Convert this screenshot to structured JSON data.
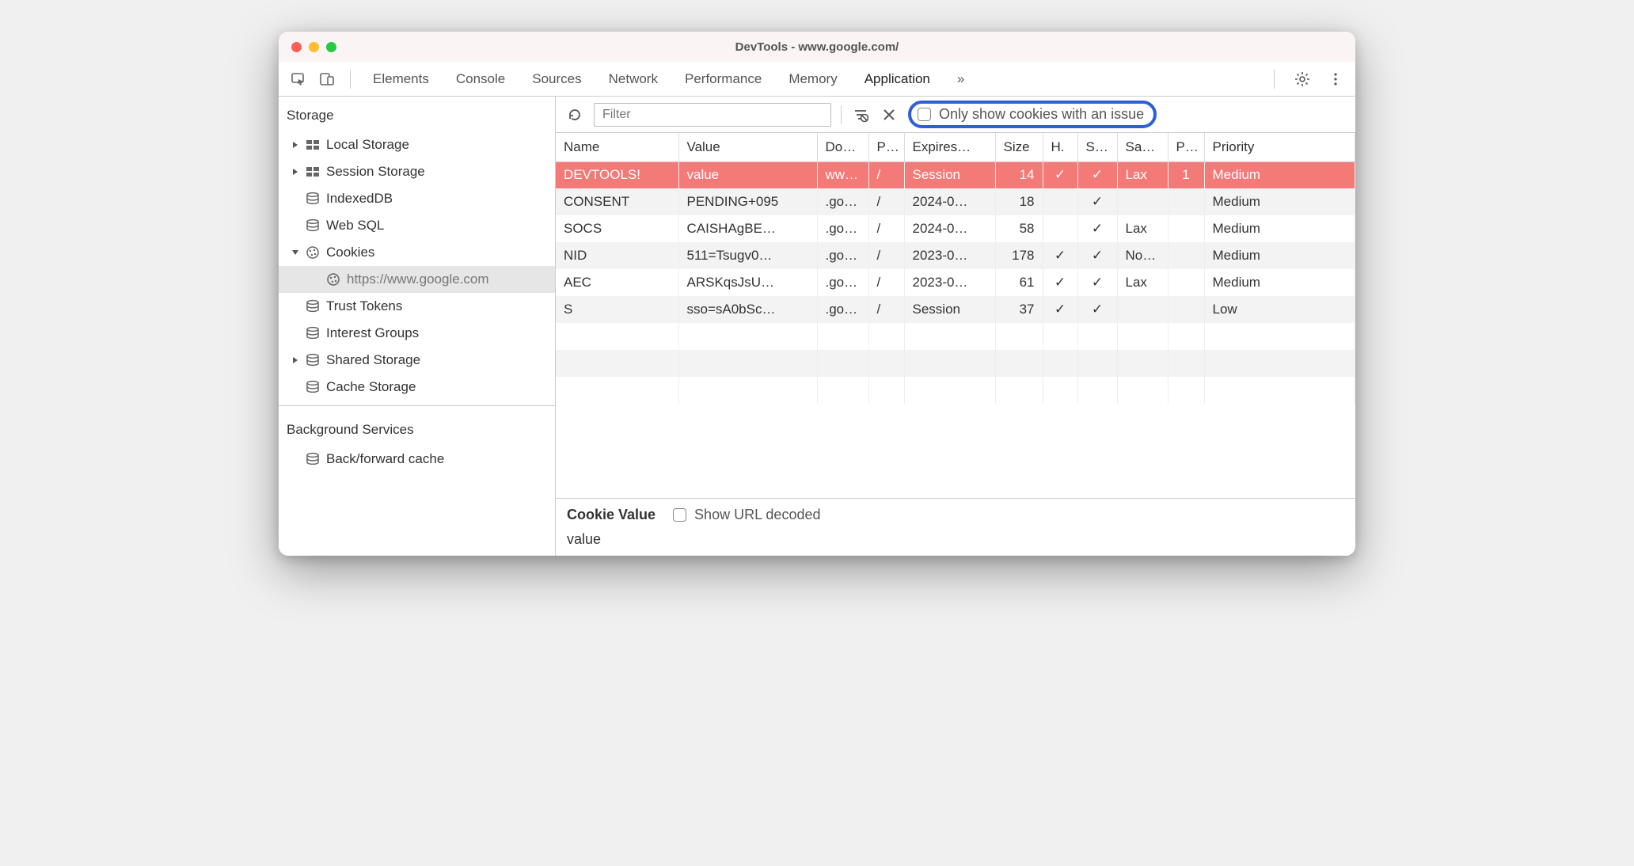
{
  "window": {
    "title": "DevTools - www.google.com/"
  },
  "tabs": [
    "Elements",
    "Console",
    "Sources",
    "Network",
    "Performance",
    "Memory",
    "Application"
  ],
  "active_tab": "Application",
  "sidebar": {
    "storage_title": "Storage",
    "items": [
      {
        "label": "Local Storage",
        "icon": "grid",
        "tri": "right"
      },
      {
        "label": "Session Storage",
        "icon": "grid",
        "tri": "right"
      },
      {
        "label": "IndexedDB",
        "icon": "db",
        "tri": ""
      },
      {
        "label": "Web SQL",
        "icon": "db",
        "tri": ""
      },
      {
        "label": "Cookies",
        "icon": "cookie",
        "tri": "down"
      },
      {
        "label": "https://www.google.com",
        "icon": "cookie",
        "tri": "",
        "indent": true,
        "selected": true
      },
      {
        "label": "Trust Tokens",
        "icon": "db",
        "tri": ""
      },
      {
        "label": "Interest Groups",
        "icon": "db",
        "tri": ""
      },
      {
        "label": "Shared Storage",
        "icon": "db",
        "tri": "right"
      },
      {
        "label": "Cache Storage",
        "icon": "db",
        "tri": ""
      }
    ],
    "bg_title": "Background Services",
    "bg_items": [
      {
        "label": "Back/forward cache",
        "icon": "db",
        "tri": ""
      }
    ]
  },
  "filterbar": {
    "placeholder": "Filter",
    "only_issue_label": "Only show cookies with an issue"
  },
  "columns": [
    "Name",
    "Value",
    "Do…",
    "P…",
    "Expires…",
    "Size",
    "H.",
    "S…",
    "Sa…",
    "P…",
    "Priority"
  ],
  "rows": [
    {
      "hl": true,
      "name": "DEVTOOLS!",
      "value": "value",
      "domain": "ww…",
      "path": "/",
      "expires": "Session",
      "size": "14",
      "http": "✓",
      "secure": "✓",
      "same": "Lax",
      "pkey": "1",
      "priority": "Medium"
    },
    {
      "hl": false,
      "name": "CONSENT",
      "value": "PENDING+095",
      "domain": ".go…",
      "path": "/",
      "expires": "2024-0…",
      "size": "18",
      "http": "",
      "secure": "✓",
      "same": "",
      "pkey": "",
      "priority": "Medium"
    },
    {
      "hl": false,
      "name": "SOCS",
      "value": "CAISHAgBE…",
      "domain": ".go…",
      "path": "/",
      "expires": "2024-0…",
      "size": "58",
      "http": "",
      "secure": "✓",
      "same": "Lax",
      "pkey": "",
      "priority": "Medium"
    },
    {
      "hl": false,
      "name": "NID",
      "value": "511=Tsugv0…",
      "domain": ".go…",
      "path": "/",
      "expires": "2023-0…",
      "size": "178",
      "http": "✓",
      "secure": "✓",
      "same": "No…",
      "pkey": "",
      "priority": "Medium"
    },
    {
      "hl": false,
      "name": "AEC",
      "value": "ARSKqsJsU…",
      "domain": ".go…",
      "path": "/",
      "expires": "2023-0…",
      "size": "61",
      "http": "✓",
      "secure": "✓",
      "same": "Lax",
      "pkey": "",
      "priority": "Medium"
    },
    {
      "hl": false,
      "name": "S",
      "value": "sso=sA0bSc…",
      "domain": ".go…",
      "path": "/",
      "expires": "Session",
      "size": "37",
      "http": "✓",
      "secure": "✓",
      "same": "",
      "pkey": "",
      "priority": "Low"
    }
  ],
  "detail": {
    "label": "Cookie Value",
    "decoded_label": "Show URL decoded",
    "value": "value"
  }
}
